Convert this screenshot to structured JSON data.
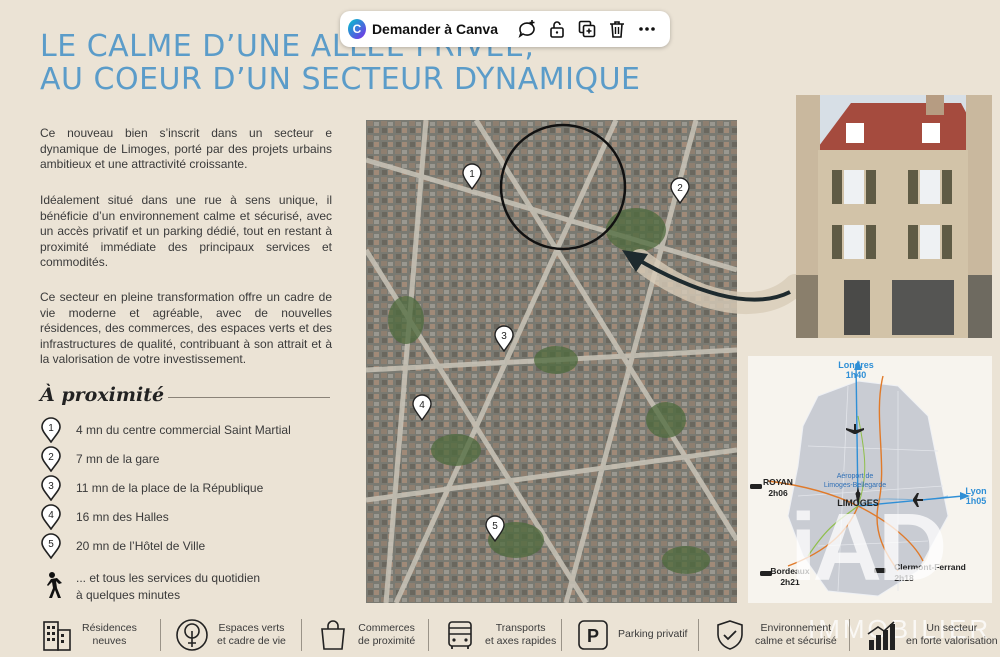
{
  "toolbar": {
    "ask_label": "Demander à Canva",
    "icons": [
      "comment-plus-icon",
      "lock-icon",
      "duplicate-icon",
      "trash-icon",
      "more-icon"
    ]
  },
  "title": {
    "line1": "LE CALME D’UNE ALLÉE PRIVÉE,",
    "line2": "AU COEUR D’UN SECTEUR DYNAMIQUE"
  },
  "intro": {
    "p1": "Ce nouveau bien s’inscrit dans un secteur e dynamique de Limoges, porté par des projets urbains ambitieux et une attractivité croissante.",
    "p2": "Idéalement situé dans une rue à sens unique, il bénéficie d’un environnement calme et sécurisé, avec un accès privatif et un parking dédié, tout en restant à proximité immédiate des principaux services et commodités.",
    "p3": "Ce secteur en pleine transformation offre un cadre de vie moderne et agréable, avec de nouvelles résidences, des commerces, des espaces verts et des infrastructures de qualité, contribuant à son attrait et à la valorisation de votre investissement."
  },
  "proximity": {
    "title": "À proximité",
    "items": [
      {
        "num": "1",
        "text": "4 mn du centre commercial Saint Martial"
      },
      {
        "num": "2",
        "text": "7 mn de la gare"
      },
      {
        "num": "3",
        "text": "11 mn de la place de la République"
      },
      {
        "num": "4",
        "text": "16 mn des Halles"
      },
      {
        "num": "5",
        "text": "20 mn de l’Hôtel de Ville"
      }
    ],
    "services_line1": "... et tous les services du quotidien",
    "services_line2": "à quelques minutes"
  },
  "map_markers": [
    "1",
    "2",
    "3",
    "4",
    "5"
  ],
  "inset_map": {
    "londres": "Londres",
    "londres_time": "1h40",
    "royan": "ROYAN",
    "royan_time": "2h06",
    "airport_line1": "Aéroport de",
    "airport_line2": "Limoges-Bellegarde",
    "limoges": "LIMOGES",
    "lyon": "Lyon",
    "lyon_time": "1h05",
    "bordeaux": "Bordeaux",
    "bordeaux_time": "2h21",
    "clermont": "Clermont-Ferrand",
    "clermont_time": "2h18"
  },
  "footer": [
    {
      "icon": "residences-icon",
      "line1": "Résidences",
      "line2": "neuves"
    },
    {
      "icon": "tree-icon",
      "line1": "Espaces verts",
      "line2": "et cadre de vie"
    },
    {
      "icon": "shopping-bag-icon",
      "line1": "Commerces",
      "line2": "de proximité"
    },
    {
      "icon": "bus-icon",
      "line1": "Transports",
      "line2": "et axes rapides"
    },
    {
      "icon": "parking-icon",
      "line1": "Parking privatif",
      "line2": ""
    },
    {
      "icon": "shield-check-icon",
      "line1": "Environnement",
      "line2": "calme et sécurisé"
    },
    {
      "icon": "growth-chart-icon",
      "line1": "Un secteur",
      "line2": "en forte valorisation"
    }
  ],
  "watermark": {
    "logo": "iAD",
    "sub": "IMMOBILIER"
  },
  "colors": {
    "title": "#5b9cc9",
    "background": "#ebe3d5",
    "route_blue": "#2f8fd6",
    "route_orange": "#e07a2a"
  }
}
